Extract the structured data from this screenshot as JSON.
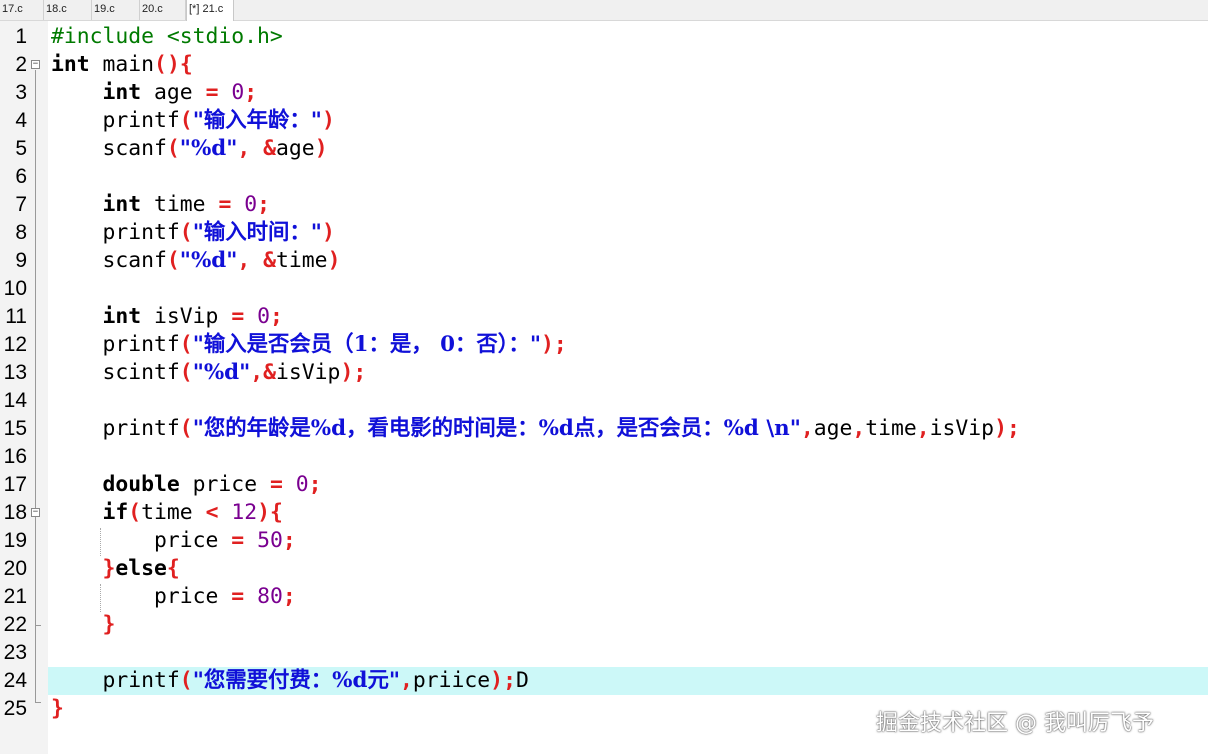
{
  "tabs": [
    "17.c",
    "18.c",
    "19.c",
    "20.c",
    "[*] 21.c"
  ],
  "active_tab": 4,
  "current_line": 24,
  "line_numbers": [
    "1",
    "2",
    "3",
    "4",
    "5",
    "6",
    "7",
    "8",
    "9",
    "10",
    "11",
    "12",
    "13",
    "14",
    "15",
    "16",
    "17",
    "18",
    "19",
    "20",
    "21",
    "22",
    "23",
    "24",
    "25"
  ],
  "code_lines": [
    "#include <stdio.h>",
    "int main(){",
    "    int age = 0;",
    "    printf(\"输入年龄：\")",
    "    scanf(\"%d\", &age)",
    "",
    "    int time = 0;",
    "    printf(\"输入时间：\")",
    "    scanf(\"%d\", &time)",
    "",
    "    int isVip = 0;",
    "    printf(\"输入是否会员（1：是， 0：否）：\");",
    "    scintf(\"%d\",&isVip);",
    "",
    "    printf(\"您的年龄是%d，看电影的时间是：%d点，是否会员：%d \\n\",age,time,isVip);",
    "",
    "    double price = 0;",
    "    if(time < 12){",
    "        price = 50;",
    "    }else{",
    "        price = 80;",
    "    }",
    "",
    "    printf(\"您需要付费：%d元\",priice);D",
    "}"
  ],
  "watermark": "掘金技术社区 @ 我叫厉飞予",
  "colors": {
    "keyword": "#000000",
    "preprocessor": "#007a00",
    "operator": "#e02020",
    "number": "#7a0090",
    "string": "#1010d8",
    "current_line_bg": "#ccf8f8",
    "gutter_bg": "#f3f3f3"
  }
}
